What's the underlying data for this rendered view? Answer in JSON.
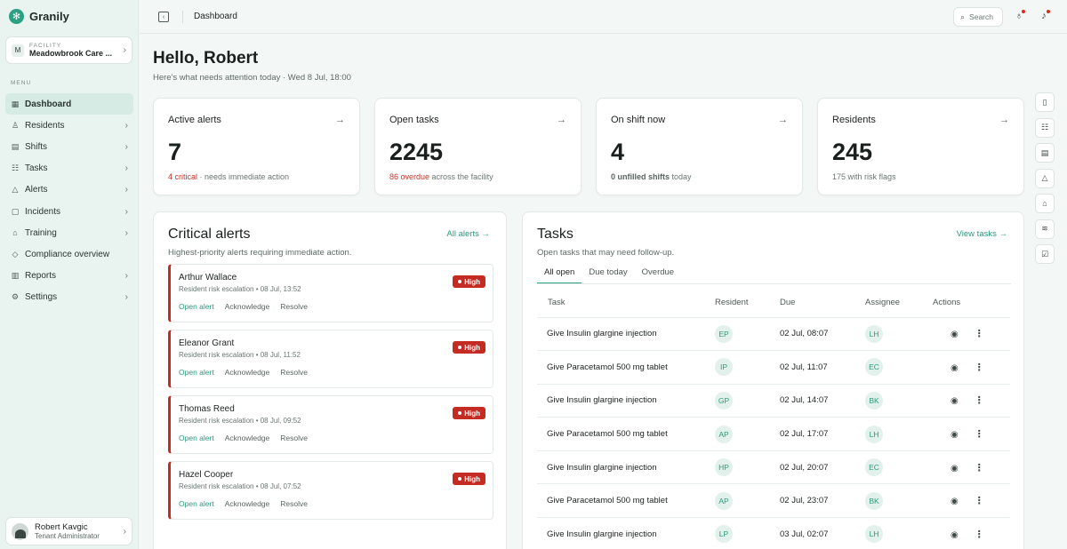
{
  "app": {
    "name": "Granily"
  },
  "facility": {
    "label": "FACILITY",
    "badge": "M",
    "name": "Meadowbrook Care ..."
  },
  "menu_label": "MENU",
  "nav": [
    {
      "label": "Dashboard",
      "icon": "grid-icon",
      "glyph": "▦",
      "active": true,
      "chevron": false
    },
    {
      "label": "Residents",
      "icon": "user-icon",
      "glyph": "♙",
      "active": false,
      "chevron": true
    },
    {
      "label": "Shifts",
      "icon": "calendar-icon",
      "glyph": "▤",
      "active": false,
      "chevron": true
    },
    {
      "label": "Tasks",
      "icon": "checklist-icon",
      "glyph": "☷",
      "active": false,
      "chevron": true
    },
    {
      "label": "Alerts",
      "icon": "warning-icon",
      "glyph": "△",
      "active": false,
      "chevron": true
    },
    {
      "label": "Incidents",
      "icon": "document-icon",
      "glyph": "▢",
      "active": false,
      "chevron": true
    },
    {
      "label": "Training",
      "icon": "graduation-cap-icon",
      "glyph": "⌂",
      "active": false,
      "chevron": true
    },
    {
      "label": "Compliance overview",
      "icon": "shield-icon",
      "glyph": "◇",
      "active": false,
      "chevron": false
    },
    {
      "label": "Reports",
      "icon": "bar-chart-icon",
      "glyph": "▥",
      "active": false,
      "chevron": true
    },
    {
      "label": "Settings",
      "icon": "gear-icon",
      "glyph": "⚙",
      "active": false,
      "chevron": true
    }
  ],
  "user": {
    "name": "Robert Kavgic",
    "role": "Tenant Administrator"
  },
  "topbar": {
    "title": "Dashboard",
    "search_label": "Search"
  },
  "greeting": {
    "title": "Hello, Robert",
    "subtitle": "Here's what needs attention today · Wed 8 Jul, 18:00"
  },
  "stats": [
    {
      "title": "Active alerts",
      "value": "7",
      "note_strong": "4 critical",
      "note_rest": " · needs immediate action",
      "strong_style": "red"
    },
    {
      "title": "Open tasks",
      "value": "2245",
      "note_strong": "86 overdue",
      "note_rest": " across the facility",
      "strong_style": "red"
    },
    {
      "title": "On shift now",
      "value": "4",
      "note_strong": "0 unfilled shifts",
      "note_rest": " today",
      "strong_style": "bold"
    },
    {
      "title": "Residents",
      "value": "245",
      "note_strong": "",
      "note_rest": "175 with risk flags",
      "strong_style": "none"
    }
  ],
  "critical_alerts": {
    "title": "Critical alerts",
    "subtitle": "Highest-priority alerts requiring immediate action.",
    "link": "All alerts →",
    "badge": "High",
    "actions": [
      "Open alert",
      "Acknowledge",
      "Resolve"
    ],
    "items": [
      {
        "name": "Arthur Wallace",
        "meta": "Resident risk escalation • 08 Jul, 13:52"
      },
      {
        "name": "Eleanor Grant",
        "meta": "Resident risk escalation • 08 Jul, 11:52"
      },
      {
        "name": "Thomas Reed",
        "meta": "Resident risk escalation • 08 Jul, 09:52"
      },
      {
        "name": "Hazel Cooper",
        "meta": "Resident risk escalation • 08 Jul, 07:52"
      }
    ]
  },
  "tasks": {
    "title": "Tasks",
    "subtitle": "Open tasks that may need follow-up.",
    "link": "View tasks →",
    "tabs": [
      "All open",
      "Due today",
      "Overdue"
    ],
    "columns": [
      "Task",
      "Resident",
      "Due",
      "Assignee",
      "Actions"
    ],
    "rows": [
      {
        "task": "Give Insulin glargine injection",
        "resident": "EP",
        "due": "02 Jul, 08:07",
        "assignee": "LH"
      },
      {
        "task": "Give Paracetamol 500 mg tablet",
        "resident": "IP",
        "due": "02 Jul, 11:07",
        "assignee": "EC"
      },
      {
        "task": "Give Insulin glargine injection",
        "resident": "GP",
        "due": "02 Jul, 14:07",
        "assignee": "BK"
      },
      {
        "task": "Give Paracetamol 500 mg tablet",
        "resident": "AP",
        "due": "02 Jul, 17:07",
        "assignee": "LH"
      },
      {
        "task": "Give Insulin glargine injection",
        "resident": "HP",
        "due": "02 Jul, 20:07",
        "assignee": "EC"
      },
      {
        "task": "Give Paracetamol 500 mg tablet",
        "resident": "AP",
        "due": "02 Jul, 23:07",
        "assignee": "BK"
      },
      {
        "task": "Give Insulin glargine injection",
        "resident": "LP",
        "due": "03 Jul, 02:07",
        "assignee": "LH"
      }
    ]
  },
  "rail": [
    {
      "icon": "document-icon",
      "glyph": "▯"
    },
    {
      "icon": "checklist-icon",
      "glyph": "☷"
    },
    {
      "icon": "calendar-icon",
      "glyph": "▤"
    },
    {
      "icon": "warning-icon",
      "glyph": "△"
    },
    {
      "icon": "graduation-cap-icon",
      "glyph": "⌂"
    },
    {
      "icon": "activity-icon",
      "glyph": "≋"
    },
    {
      "icon": "checkbox-icon",
      "glyph": "☑"
    }
  ],
  "colors": {
    "accent": "#2aa183",
    "critical": "#c42b22"
  }
}
